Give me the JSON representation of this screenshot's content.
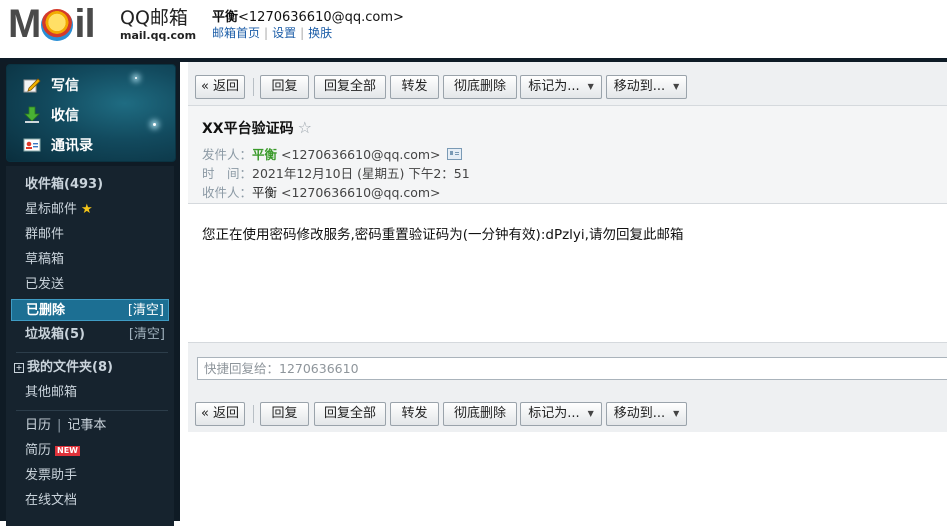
{
  "header": {
    "logo_big": "M",
    "logo_big2": "il",
    "logo_title": "QQ邮箱",
    "logo_domain": "mail.qq.com",
    "user_name": "平衡",
    "user_email": "<1270636610@qq.com>",
    "links": [
      "邮箱首页",
      "设置",
      "换肤"
    ]
  },
  "sidebar": {
    "quick": {
      "write": "写信",
      "inbox": "收信",
      "contacts": "通讯录"
    },
    "folders": {
      "inbox": {
        "label": "收件箱(493)"
      },
      "starred": {
        "label": "星标邮件"
      },
      "group": {
        "label": "群邮件"
      },
      "drafts": {
        "label": "草稿箱"
      },
      "sent": {
        "label": "已发送"
      },
      "deleted": {
        "label": "已删除",
        "action": "[清空]"
      },
      "spam": {
        "label": "垃圾箱(5)",
        "action": "[清空]"
      },
      "my_folders": {
        "label": "我的文件夹(8)"
      },
      "other": {
        "label": "其他邮箱"
      },
      "calendar": {
        "label": "日历"
      },
      "notes": {
        "label": "记事本"
      },
      "resume": {
        "label": "简历",
        "badge": "NEW"
      },
      "invoice": {
        "label": "发票助手"
      },
      "docs": {
        "label": "在线文档"
      }
    }
  },
  "toolbar": {
    "back": "« 返回",
    "reply": "回复",
    "reply_all": "回复全部",
    "forward": "转发",
    "delete_perm": "彻底删除",
    "mark_as": "标记为...",
    "move_to": "移动到..."
  },
  "mail": {
    "subject": "XX平台验证码",
    "from_label": "发件人：",
    "from_name": "平衡",
    "from_email": "<1270636610@qq.com>",
    "time_label": "时　间：",
    "time": "2021年12月10日 (星期五) 下午2：51",
    "to_label": "收件人：",
    "to_name": "平衡",
    "to_email": "<1270636610@qq.com>",
    "body": "您正在使用密码修改服务,密码重置验证码为(一分钟有效):dPzlyi,请勿回复此邮箱"
  },
  "quick_reply": {
    "placeholder": "快捷回复给：1270636610"
  },
  "colors": {
    "sidebar_bg": "#0f1b25",
    "active_folder": "#1c6f93",
    "sender_green": "#3a9a2a",
    "link_blue": "#1d5ea8"
  }
}
